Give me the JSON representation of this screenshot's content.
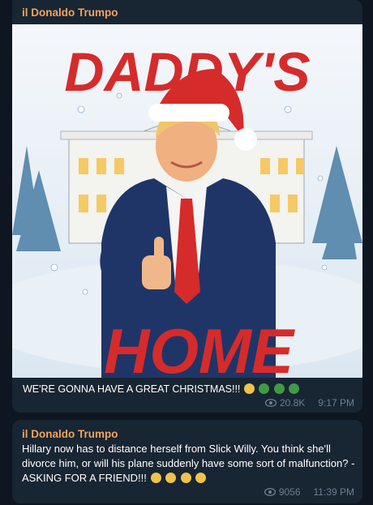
{
  "messages": [
    {
      "sender": "il Donaldo Trumpo",
      "image": {
        "title_top": "DADDY'S",
        "title_bottom": "HOME"
      },
      "caption": "WE'RE GONNA HAVE A GREAT CHRISTMAS!!!",
      "caption_emojis": [
        "santa-emoji",
        "christmas-tree-emoji",
        "christmas-tree-emoji",
        "christmas-tree-emoji"
      ],
      "views": "20.8K",
      "time": "9:17 PM"
    },
    {
      "sender": "il Donaldo Trumpo",
      "text": "Hillary now has to distance herself from Slick Willy. You think she'll divorce him, or will his plane suddenly have some sort of malfunction? -ASKING FOR A FRIEND!!!",
      "text_emojis": [
        "winking-tongue-emoji",
        "tears-of-joy-emoji",
        "tears-of-joy-emoji",
        "tears-of-joy-emoji"
      ],
      "views": "9056",
      "time": "11:39 PM"
    }
  ],
  "colors": {
    "background": "#0e1621",
    "bubble": "#182533",
    "sender": "#f3a35c",
    "meta": "#6d7f8f",
    "poster_red": "#d62b2b"
  }
}
